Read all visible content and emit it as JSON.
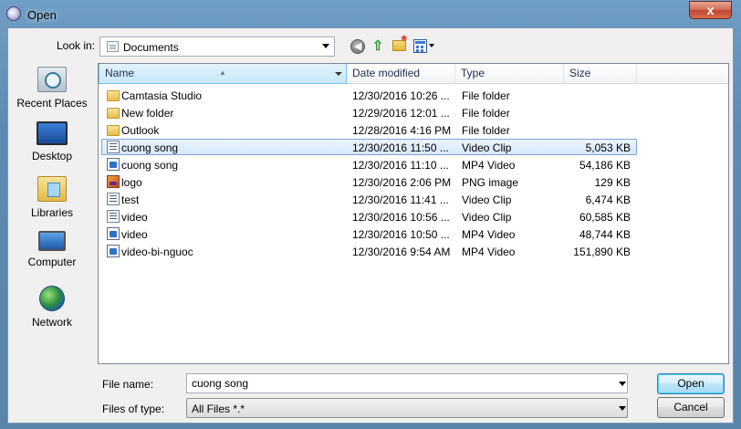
{
  "window": {
    "title": "Open",
    "close_label": "x"
  },
  "toolbar": {
    "lookin_label": "Look in:",
    "lookin_value": "Documents",
    "icons": [
      "back-icon",
      "up-folder-icon",
      "new-folder-icon",
      "views-menu-icon"
    ]
  },
  "places": [
    {
      "label": "Recent Places",
      "icon": "recent-places-icon"
    },
    {
      "label": "Desktop",
      "icon": "desktop-icon"
    },
    {
      "label": "Libraries",
      "icon": "libraries-icon"
    },
    {
      "label": "Computer",
      "icon": "computer-icon"
    },
    {
      "label": "Network",
      "icon": "network-icon"
    }
  ],
  "columns": {
    "name": "Name",
    "date": "Date modified",
    "type": "Type",
    "size": "Size"
  },
  "files": [
    {
      "name": "Camtasia Studio",
      "date": "12/30/2016 10:26 ...",
      "type": "File folder",
      "size": "",
      "icon": "folder"
    },
    {
      "name": "New folder",
      "date": "12/29/2016 12:01 ...",
      "type": "File folder",
      "size": "",
      "icon": "folder"
    },
    {
      "name": "Outlook",
      "date": "12/28/2016 4:16 PM",
      "type": "File folder",
      "size": "",
      "icon": "folder"
    },
    {
      "name": "cuong song",
      "date": "12/30/2016 11:50 ...",
      "type": "Video Clip",
      "size": "5,053 KB",
      "icon": "clip",
      "selected": true
    },
    {
      "name": "cuong song",
      "date": "12/30/2016 11:10 ...",
      "type": "MP4 Video",
      "size": "54,186 KB",
      "icon": "mp4"
    },
    {
      "name": "logo",
      "date": "12/30/2016 2:06 PM",
      "type": "PNG image",
      "size": "129 KB",
      "icon": "png"
    },
    {
      "name": "test",
      "date": "12/30/2016 11:41 ...",
      "type": "Video Clip",
      "size": "6,474 KB",
      "icon": "clip"
    },
    {
      "name": "video",
      "date": "12/30/2016 10:56 ...",
      "type": "Video Clip",
      "size": "60,585 KB",
      "icon": "clip"
    },
    {
      "name": "video",
      "date": "12/30/2016 10:50 ...",
      "type": "MP4 Video",
      "size": "48,744 KB",
      "icon": "mp4"
    },
    {
      "name": "video-bi-nguoc",
      "date": "12/30/2016 9:54 AM",
      "type": "MP4 Video",
      "size": "151,890 KB",
      "icon": "mp4"
    }
  ],
  "filename": {
    "label": "File name:",
    "value": "cuong song"
  },
  "filetype": {
    "label": "Files of type:",
    "value": "All Files *.*"
  },
  "buttons": {
    "open": "Open",
    "cancel": "Cancel"
  }
}
